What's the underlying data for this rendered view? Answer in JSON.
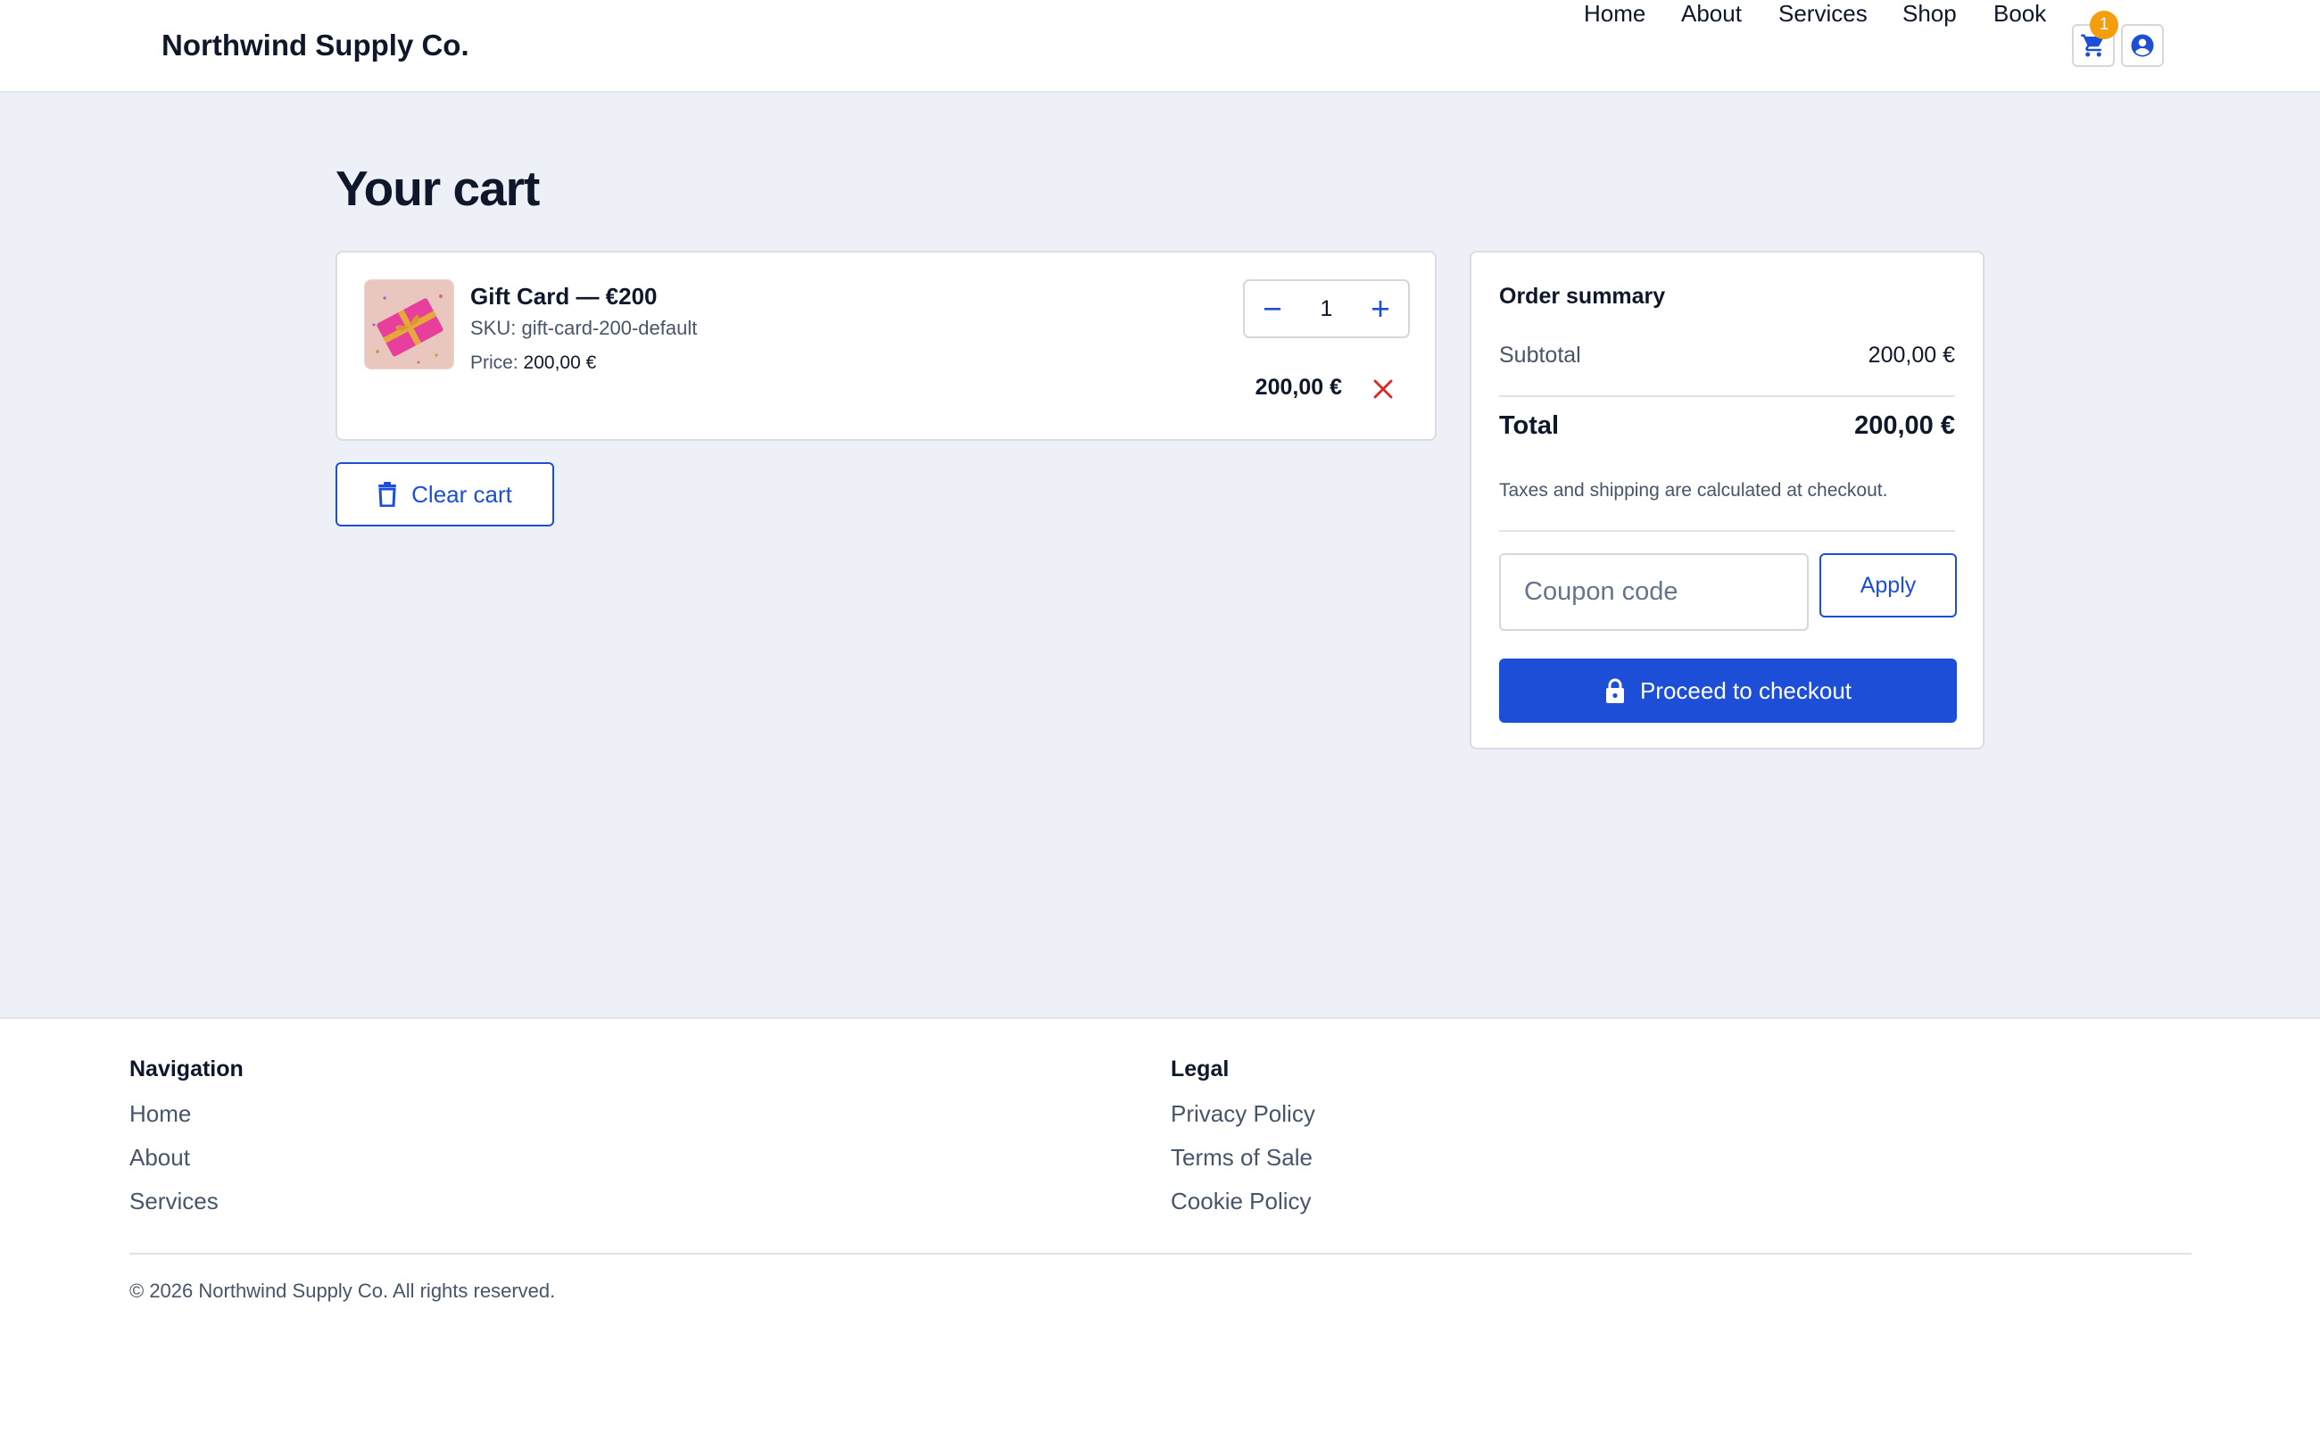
{
  "header": {
    "brand": "Northwind Supply Co.",
    "nav": [
      {
        "label": "Home"
      },
      {
        "label": "About"
      },
      {
        "label": "Services"
      },
      {
        "label": "Shop"
      },
      {
        "label": "Book"
      }
    ],
    "cart_badge_count": "1",
    "cart_icon": "cart-icon",
    "account_icon": "user-circle-icon"
  },
  "main": {
    "title": "Your cart",
    "item": {
      "name": "Gift Card — €200",
      "sku": "SKU: gift-card-200-default",
      "price_label": "Price:",
      "price_value": "200,00 €",
      "quantity": "1",
      "line_total": "200,00 €",
      "thumbnail_icon": "gift-box-image"
    },
    "clear_cart_label": "Clear cart"
  },
  "summary": {
    "title": "Order summary",
    "subtotal_label": "Subtotal",
    "subtotal_value": "200,00 €",
    "total_label": "Total",
    "total_value": "200,00 €",
    "tax_note": "Taxes and shipping are calculated at checkout.",
    "coupon_placeholder": "Coupon code",
    "apply_label": "Apply",
    "checkout_label": "Proceed to checkout"
  },
  "footer": {
    "nav_title": "Navigation",
    "nav_links": [
      {
        "label": "Home"
      },
      {
        "label": "About"
      },
      {
        "label": "Services"
      }
    ],
    "legal_title": "Legal",
    "legal_links": [
      {
        "label": "Privacy Policy"
      },
      {
        "label": "Terms of Sale"
      },
      {
        "label": "Cookie Policy"
      }
    ],
    "copyright": "© 2026 Northwind Supply Co. All rights reserved."
  },
  "colors": {
    "accent": "#1d4ed8",
    "badge": "#f59e0b",
    "danger": "#dc2626",
    "page_bg": "#edf1f7"
  }
}
